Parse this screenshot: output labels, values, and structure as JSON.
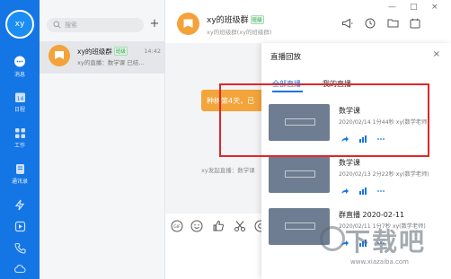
{
  "rail": {
    "avatar_text": "xy",
    "items": [
      {
        "label": "消息",
        "icon": "chat-icon"
      },
      {
        "label": "日程",
        "icon": "calendar-icon"
      },
      {
        "label": "工作",
        "icon": "apps-icon"
      },
      {
        "label": "通讯录",
        "icon": "contacts-icon"
      },
      {
        "label": "",
        "icon": "lightning-icon"
      },
      {
        "label": "",
        "icon": "play-icon"
      },
      {
        "label": "",
        "icon": "phone-icon"
      },
      {
        "label": "",
        "icon": "cloud-icon"
      }
    ]
  },
  "conversations": {
    "search_placeholder": "搜索",
    "add_label": "+",
    "items": [
      {
        "name": "xy的班级群",
        "badge": "班级",
        "time": "14:42",
        "preview": "xy的直播：数学课 已结..."
      }
    ]
  },
  "chat": {
    "title": "xy的班级群",
    "badge": "班级",
    "subtitle": "xy的班级群(xy的班级群)",
    "card_text": "种树第4天，已",
    "system_message": "xy发起直播：数学课",
    "window_controls": [
      "—",
      "□",
      "×"
    ],
    "header_icons": [
      "megaphone-icon",
      "clock-icon",
      "folder-icon",
      "calendar-icon"
    ],
    "toolbar_icons": [
      "gif-icon",
      "emoji-icon",
      "thumbs-up-icon",
      "scissors-icon",
      "at-icon"
    ]
  },
  "panel": {
    "title": "直播回放",
    "close": "×",
    "tabs": [
      {
        "label": "全部直播",
        "active": true
      },
      {
        "label": "我的直播",
        "active": false
      }
    ],
    "recordings": [
      {
        "title": "数学课",
        "meta": "2020/02/14 1分44秒 xy(数学老师)"
      },
      {
        "title": "数学课",
        "meta": "2020/02/13 2分22秒 xy(数学老师)"
      },
      {
        "title": "群直播 2020-02-11",
        "meta": "2020/02/11 1分7秒 xy(数学老师)"
      }
    ]
  },
  "watermark": {
    "big": "下载吧",
    "url": "www.xiazaiba.com"
  },
  "colors": {
    "rail": "#1475e5",
    "accent": "#1475e5",
    "highlight": "#e0262b",
    "group_avatar": "#f4a23a"
  }
}
